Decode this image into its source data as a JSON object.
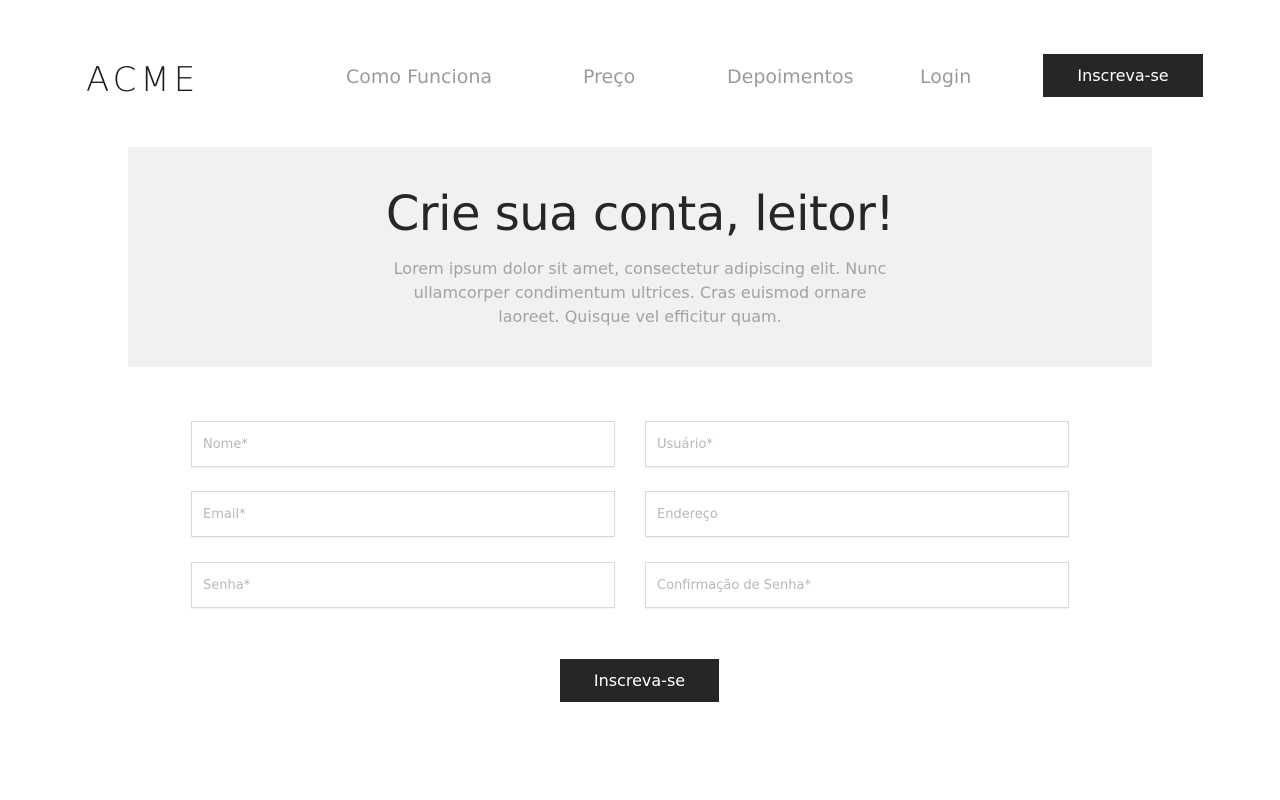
{
  "header": {
    "logo": "ACME",
    "nav": [
      {
        "label": "Como Funciona"
      },
      {
        "label": "Preço"
      },
      {
        "label": "Depoimentos"
      },
      {
        "label": "Login"
      }
    ],
    "cta_label": "Inscreva-se"
  },
  "hero": {
    "title": "Crie sua conta, leitor!",
    "subtitle": "Lorem ipsum dolor sit amet, consectetur adipiscing elit. Nunc ullamcorper condimentum ultrices. Cras euismod ornare laoreet. Quisque vel efficitur quam."
  },
  "form": {
    "fields": [
      {
        "placeholder": "Nome*",
        "value": ""
      },
      {
        "placeholder": "Usuário*",
        "value": ""
      },
      {
        "placeholder": "Email*",
        "value": ""
      },
      {
        "placeholder": "Endereço",
        "value": ""
      },
      {
        "placeholder": "Senha*",
        "value": ""
      },
      {
        "placeholder": "Confirmação de Senha*",
        "value": ""
      }
    ],
    "submit_label": "Inscreva-se"
  },
  "colors": {
    "dark": "#262626",
    "hero_bg": "#f1f1f1",
    "nav_text": "#9b9b9b"
  }
}
